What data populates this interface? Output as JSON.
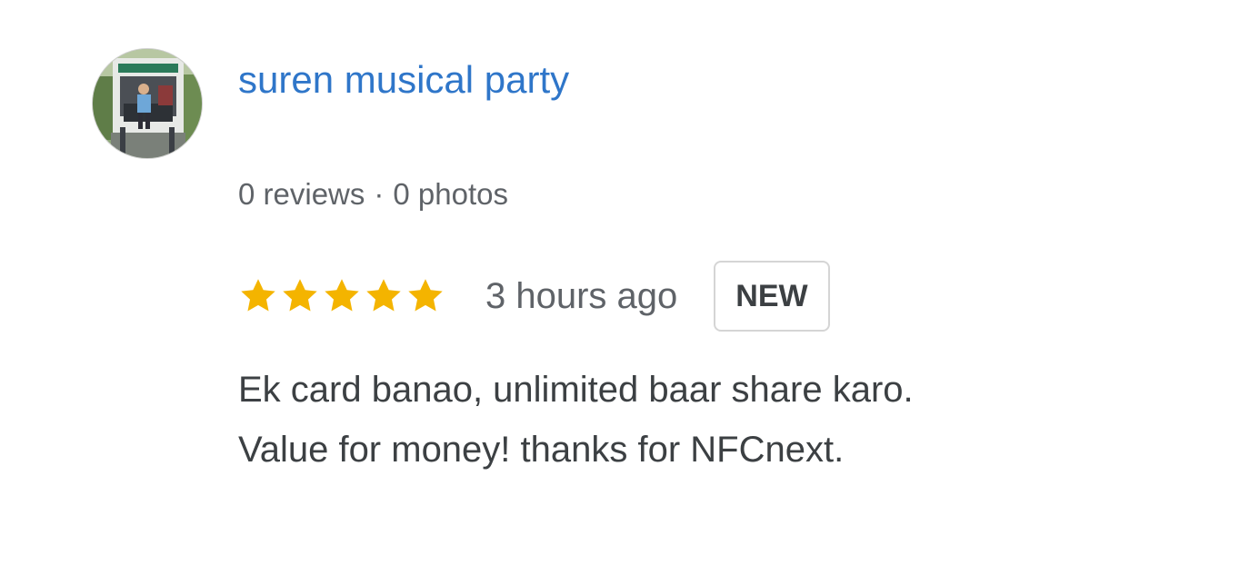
{
  "reviewer": {
    "avatar_icon": "user-photo-avatar",
    "name": "suren musical party",
    "reviews_count": "0 reviews",
    "separator": "·",
    "photos_count": "0 photos"
  },
  "review": {
    "rating": 5,
    "rating_max": 5,
    "star_icon": "star-icon",
    "star_color": "#f4b400",
    "time_ago": "3 hours ago",
    "badge": "NEW",
    "text_lines": [
      "Ek card banao, unlimited baar share karo.",
      "Value for money! thanks for NFCnext."
    ]
  },
  "colors": {
    "name_link": "#2f76c9",
    "meta_text": "#5f6368",
    "body_text": "#3c4043"
  }
}
